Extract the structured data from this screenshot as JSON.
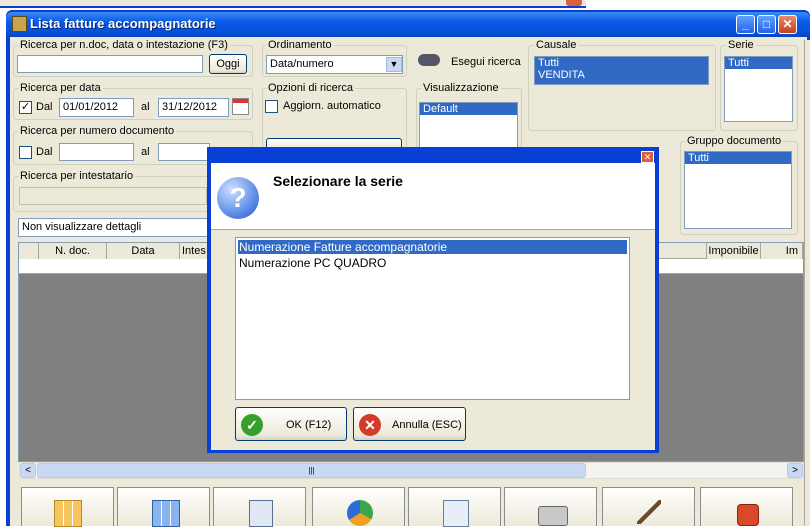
{
  "window": {
    "title": "Lista fatture accompagnatorie",
    "min": "_",
    "max": "□",
    "close": "✕"
  },
  "search": {
    "group_label": "Ricerca per n.doc, data o intestazione (F3)",
    "value": "",
    "today_button": "Oggi"
  },
  "ordering": {
    "label": "Ordinamento",
    "selected": "Data/numero"
  },
  "run_search_button": "Esegui ricerca",
  "date_search": {
    "label": "Ricerca per data",
    "from_label": "Dal",
    "from_value": "01/01/2012",
    "to_label": "al",
    "to_value": "31/12/2012",
    "checked": "✓"
  },
  "options": {
    "label": "Opzioni di ricerca",
    "auto_update": "Aggiorn. automatico"
  },
  "view": {
    "label": "Visualizzazione",
    "items": [
      "Default"
    ]
  },
  "causale": {
    "label": "Causale",
    "items": [
      "Tutti",
      "VENDITA"
    ]
  },
  "serie": {
    "label": "Serie",
    "items": [
      "Tutti"
    ]
  },
  "doc_search": {
    "label": "Ricerca per numero documento",
    "from_label": "Dal",
    "to_label": "al"
  },
  "holder_search": {
    "label": "Ricerca per intestatario"
  },
  "doc_group": {
    "label": "Gruppo documento",
    "items": [
      "Tutti"
    ]
  },
  "details_select": "Non visualizzare dettagli",
  "grid": {
    "columns": [
      "N. doc.",
      "Data",
      "Intes",
      "Imponibile",
      "Im"
    ]
  },
  "dialog": {
    "close": "✕",
    "icon": "?",
    "heading": "Selezionare la serie",
    "items": [
      "Numerazione Fatture accompagnatorie",
      "Numerazione PC QUADRO"
    ],
    "ok_label": "OK (F12)",
    "cancel_label": "Annulla (ESC)"
  },
  "scrollbar": {
    "left": "<",
    "right": ">",
    "grip": "|||"
  },
  "icons": [
    "app-icon",
    "binoculars-icon",
    "calendar-icon",
    "question-icon",
    "check-icon",
    "cancel-icon",
    "dropdown-arrow-icon",
    "new-doc-icon",
    "select-doc-icon",
    "copy-doc-icon",
    "recycle-icon",
    "settings-doc-icon",
    "printer-icon",
    "wizard-icon",
    "power-icon"
  ]
}
